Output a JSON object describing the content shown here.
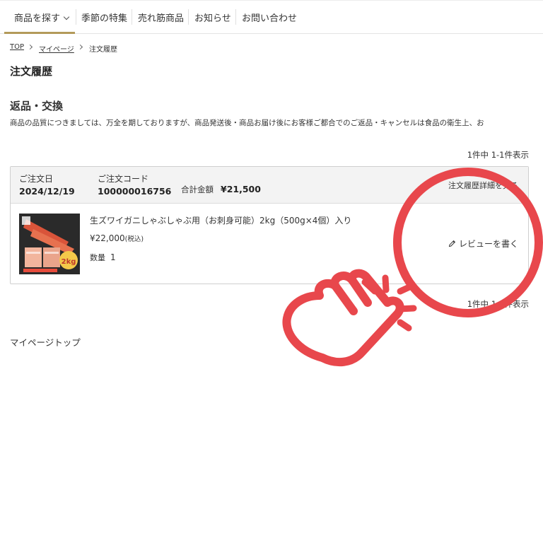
{
  "nav": {
    "items": [
      "商品を探す",
      "季節の特集",
      "売れ筋商品",
      "お知らせ",
      "お問い合わせ"
    ]
  },
  "breadcrumb": {
    "items": [
      "TOP",
      "マイページ",
      "注文履歴"
    ]
  },
  "page_title": "注文履歴",
  "returns": {
    "title": "返品・交換",
    "text": "商品の品質につきましては、万全を期しておりますが、商品発送後・商品お届け後にお客様ご都合でのご返品・キャンセルは食品の衛生上、お"
  },
  "pagination": {
    "count_top": "1件中 1-1件表示",
    "count_bottom": "1件中 1-1件表示"
  },
  "order": {
    "date_label": "ご注文日",
    "date": "2024/12/19",
    "code_label": "ご注文コード",
    "code": "100000016756",
    "total_label": "合計金額",
    "total": "¥21,500",
    "detail_link": "注文履歴詳細を見る",
    "product": {
      "name": "生ズワイガニしゃぶしゃぶ用（お刺身可能）2kg（500g×4個）入り",
      "price": "¥22,000",
      "tax_note": "(税込)",
      "qty_label": "数量",
      "qty": "1",
      "thumb_badge": "2kg"
    },
    "review_link": "レビューを書く"
  },
  "mypage_top": "マイページトップ",
  "colors": {
    "accent_gold": "#b39a5a",
    "overlay_red": "#e8474c"
  }
}
